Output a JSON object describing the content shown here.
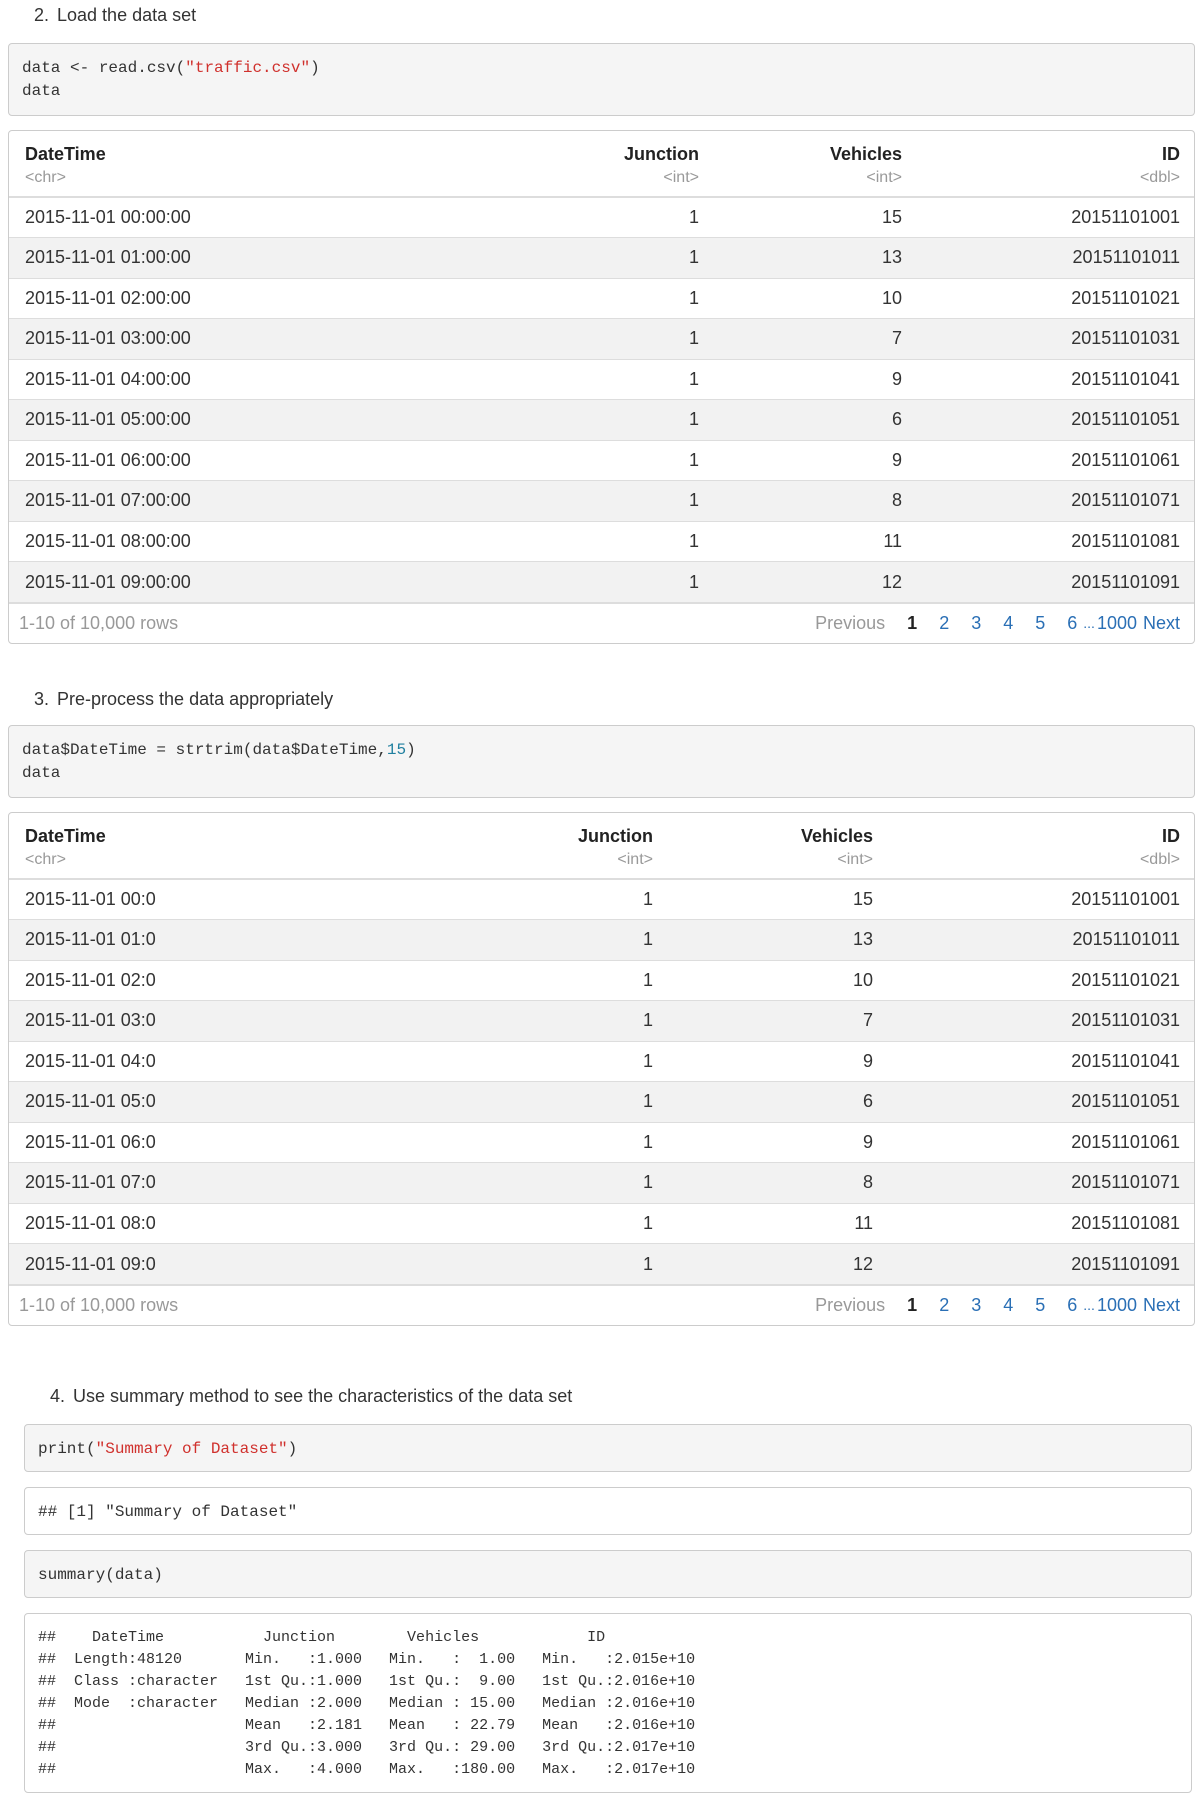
{
  "steps": [
    {
      "num": "2.",
      "text": "Load the data set"
    },
    {
      "num": "3.",
      "text": "Pre-process the data appropriately"
    },
    {
      "num": "4.",
      "text": "Use summary method to see the characteristics of the data set"
    }
  ],
  "code1": {
    "line1_pre": "data <- read.csv(",
    "line1_str": "\"traffic.csv\"",
    "line1_post": ")",
    "line2": "data"
  },
  "code2": {
    "line1_pre": "data$DateTime = strtrim(data$DateTime,",
    "line1_num": "15",
    "line1_post": ")",
    "line2": "data"
  },
  "code3": {
    "pre": "print(",
    "str": "\"Summary of Dataset\"",
    "post": ")"
  },
  "out3": "## [1] \"Summary of Dataset\"",
  "code4": "summary(data)",
  "summary_out": [
    "##    DateTime           Junction        Vehicles            ID           ",
    "##  Length:48120       Min.   :1.000   Min.   :  1.00   Min.   :2.015e+10  ",
    "##  Class :character   1st Qu.:1.000   1st Qu.:  9.00   1st Qu.:2.016e+10  ",
    "##  Mode  :character   Median :2.000   Median : 15.00   Median :2.016e+10  ",
    "##                     Mean   :2.181   Mean   : 22.79   Mean   :2.016e+10  ",
    "##                     3rd Qu.:3.000   3rd Qu.: 29.00   3rd Qu.:2.017e+10  ",
    "##                     Max.   :4.000   Max.   :180.00   Max.   :2.017e+10  "
  ],
  "table1": {
    "headers": [
      "DateTime",
      "Junction",
      "Vehicles",
      "ID"
    ],
    "types": [
      "<chr>",
      "<int>",
      "<int>",
      "<dbl>"
    ],
    "rows": [
      [
        "2015-11-01 00:00:00",
        "1",
        "15",
        "20151101001"
      ],
      [
        "2015-11-01 01:00:00",
        "1",
        "13",
        "20151101011"
      ],
      [
        "2015-11-01 02:00:00",
        "1",
        "10",
        "20151101021"
      ],
      [
        "2015-11-01 03:00:00",
        "1",
        "7",
        "20151101031"
      ],
      [
        "2015-11-01 04:00:00",
        "1",
        "9",
        "20151101041"
      ],
      [
        "2015-11-01 05:00:00",
        "1",
        "6",
        "20151101051"
      ],
      [
        "2015-11-01 06:00:00",
        "1",
        "9",
        "20151101061"
      ],
      [
        "2015-11-01 07:00:00",
        "1",
        "8",
        "20151101071"
      ],
      [
        "2015-11-01 08:00:00",
        "1",
        "11",
        "20151101081"
      ],
      [
        "2015-11-01 09:00:00",
        "1",
        "12",
        "20151101091"
      ]
    ]
  },
  "table2": {
    "headers": [
      "DateTime",
      "Junction",
      "Vehicles",
      "ID"
    ],
    "types": [
      "<chr>",
      "<int>",
      "<int>",
      "<dbl>"
    ],
    "rows": [
      [
        "2015-11-01 00:0",
        "1",
        "15",
        "20151101001"
      ],
      [
        "2015-11-01 01:0",
        "1",
        "13",
        "20151101011"
      ],
      [
        "2015-11-01 02:0",
        "1",
        "10",
        "20151101021"
      ],
      [
        "2015-11-01 03:0",
        "1",
        "7",
        "20151101031"
      ],
      [
        "2015-11-01 04:0",
        "1",
        "9",
        "20151101041"
      ],
      [
        "2015-11-01 05:0",
        "1",
        "6",
        "20151101051"
      ],
      [
        "2015-11-01 06:0",
        "1",
        "9",
        "20151101061"
      ],
      [
        "2015-11-01 07:0",
        "1",
        "8",
        "20151101071"
      ],
      [
        "2015-11-01 08:0",
        "1",
        "11",
        "20151101081"
      ],
      [
        "2015-11-01 09:0",
        "1",
        "12",
        "20151101091"
      ]
    ]
  },
  "pager": {
    "info": "1-10 of 10,000 rows",
    "previous": "Previous",
    "pages": [
      "1",
      "2",
      "3",
      "4",
      "5",
      "6"
    ],
    "ellipsis": "...",
    "last": "1000",
    "next": "Next"
  },
  "colors": {
    "string": "#d0312d",
    "number": "#1f7f9f",
    "link": "#2a6fb5",
    "muted": "#999999"
  }
}
